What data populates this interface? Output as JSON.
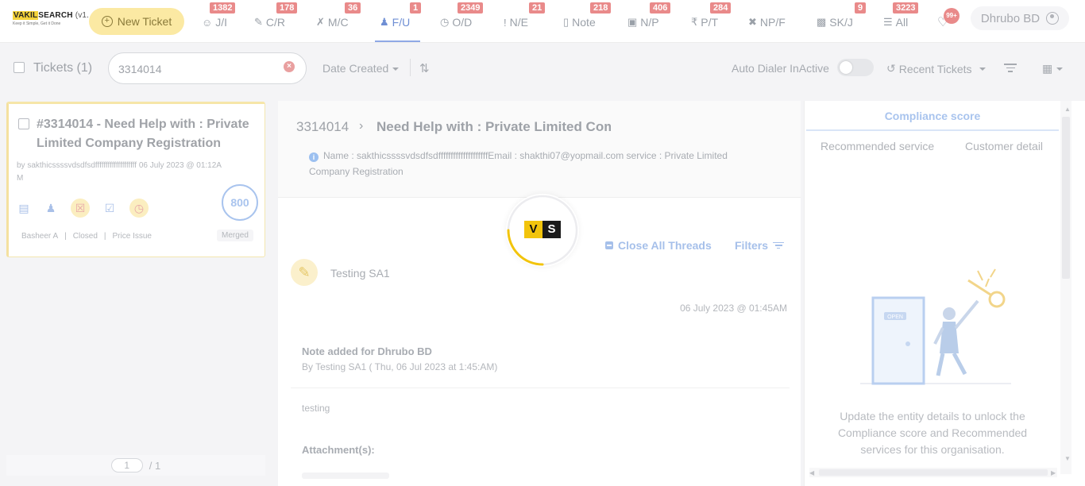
{
  "brand": {
    "name_highlight": "VAKIL",
    "name_rest": "SEARCH",
    "version": "(v1.",
    "tagline": "Keep it Simple, Get it Done"
  },
  "topnav": {
    "new_ticket_label": "New Ticket",
    "items": [
      {
        "label": "J/I",
        "count": "1382",
        "icon": "user-icon"
      },
      {
        "label": "C/R",
        "count": "178",
        "icon": "user-edit-icon"
      },
      {
        "label": "M/C",
        "count": "36",
        "icon": "tools-icon"
      },
      {
        "label": "F/U",
        "count": "1",
        "icon": "users-icon",
        "active": true
      },
      {
        "label": "O/D",
        "count": "2349",
        "icon": "clock-icon"
      },
      {
        "label": "N/E",
        "count": "21",
        "icon": "exclamation-icon"
      },
      {
        "label": "Note",
        "count": "218",
        "icon": "clipboard-icon"
      },
      {
        "label": "N/P",
        "count": "406",
        "icon": "money-icon"
      },
      {
        "label": "P/T",
        "count": "284",
        "icon": "rupee-icon"
      },
      {
        "label": "NP/F",
        "count": "",
        "icon": "no-tools-icon"
      },
      {
        "label": "SK/J",
        "count": "9",
        "icon": "building-icon"
      },
      {
        "label": "All",
        "count": "3223",
        "icon": "list-icon"
      }
    ],
    "bell_count": "99+",
    "user_name": "Dhrubo BD"
  },
  "toolbar": {
    "tickets_label": "Tickets (1)",
    "search_value": "3314014",
    "date_filter_label": "Date Created",
    "auto_dialer_label": "Auto Dialer InActive",
    "recent_tickets_label": "Recent Tickets"
  },
  "ticket_card": {
    "title": "#3314014 - Need Help with : Private Limited Company Registration",
    "meta": "by sakthicssssvdsdfsdffffffffffffffffffff 06 July 2023 @ 01:12AM",
    "score": "800",
    "assignee": "Basheer A",
    "status": "Closed",
    "issue": "Price Issue",
    "merged_label": "Merged"
  },
  "pager": {
    "current": "1",
    "total": "/ 1"
  },
  "detail": {
    "ticket_id": "3314014",
    "title": "Need Help with : Private Limited Company Registration",
    "info": "Name : sakthicssssvdsdfsdffffffffffffffffffffEmail : shakthi07@yopmail.com service : Private Limited Company Registration",
    "close_threads_label": "Close All Threads",
    "filters_label": "Filters",
    "note_author": "Testing SA1",
    "note_date": "06 July 2023 @ 01:45AM",
    "note_heading": "Note added for Dhrubo BD",
    "note_by": "By Testing SA1 ( Thu, 06 Jul 2023 at 1:45:AM)",
    "note_body": "testing",
    "attachments_label": "Attachment(s):"
  },
  "loader": {
    "mark_left": "V",
    "mark_right": "S",
    "accent": "#f2c40c"
  },
  "right_panel": {
    "compliance_tab": "Compliance score",
    "recommended_tab": "Recommended service",
    "customer_tab": "Customer detail",
    "door_sign": "OPEN",
    "message": "Update the entity details to unlock the Compliance score and Recommended services for this organisation."
  },
  "colors": {
    "accent_blue": "#6f8fd4",
    "badge_red": "#e98a8a",
    "brand_yellow": "#f2c40c"
  }
}
